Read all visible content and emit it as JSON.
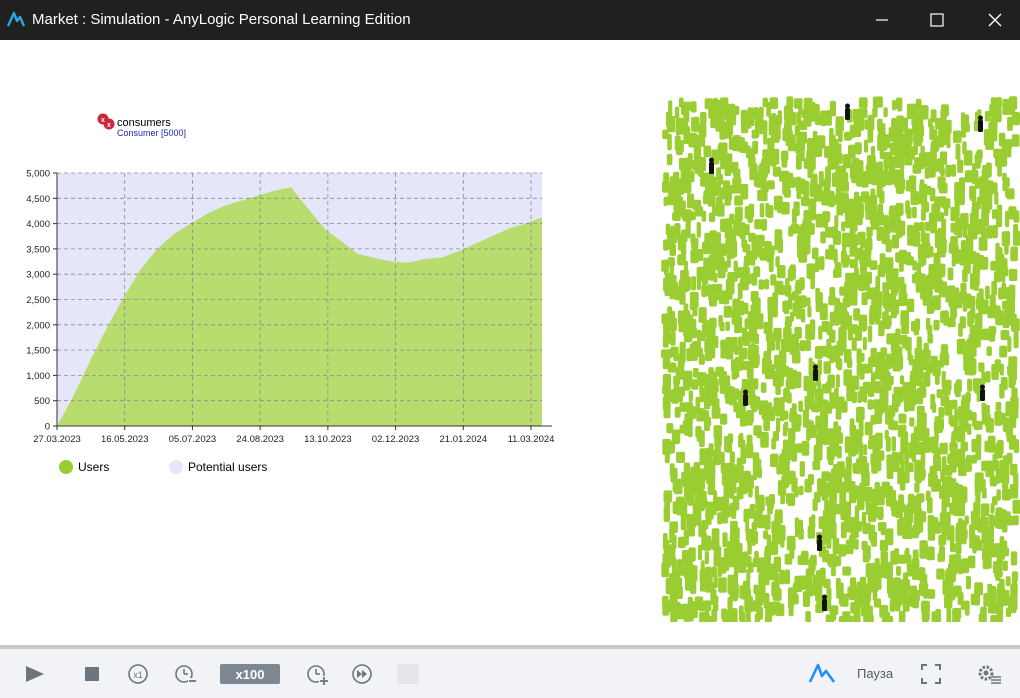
{
  "window": {
    "title": "Market : Simulation - AnyLogic Personal Learning Edition"
  },
  "agent_population": {
    "name": "consumers",
    "type_label": "Consumer [5000]"
  },
  "chart_data": {
    "type": "area",
    "x_tick_labels": [
      "27.03.2023",
      "16.05.2023",
      "05.07.2023",
      "24.08.2023",
      "13.10.2023",
      "02.12.2023",
      "21.01.2024",
      "11.03.2024"
    ],
    "y_tick_labels": [
      "0",
      "500",
      "1,000",
      "1,500",
      "2,000",
      "2,500",
      "3,000",
      "3,500",
      "4,000",
      "4,500",
      "5,000"
    ],
    "ylim": [
      0,
      5000
    ],
    "grid": true,
    "legend_position": "bottom-left",
    "series": [
      {
        "name": "Users",
        "color": "#9acd32",
        "values": [
          0,
          600,
          1300,
          1950,
          2550,
          3100,
          3500,
          3800,
          4000,
          4200,
          4350,
          4450,
          4550,
          4650,
          4720,
          4300,
          3900,
          3650,
          3400,
          3320,
          3250,
          3230,
          3300,
          3330,
          3450,
          3600,
          3750,
          3900,
          4000,
          4120
        ]
      },
      {
        "name": "Potential users",
        "color": "#e6e6fa",
        "values": [
          5000,
          4400,
          3700,
          3050,
          2450,
          1900,
          1500,
          1200,
          1000,
          800,
          650,
          550,
          450,
          350,
          280,
          700,
          1100,
          1350,
          1600,
          1680,
          1750,
          1770,
          1700,
          1670,
          1550,
          1400,
          1250,
          1100,
          1000,
          880
        ]
      }
    ]
  },
  "toolbar": {
    "speed_label": "x100",
    "pause_label": "Пауза",
    "icons": [
      "play-icon",
      "stop-icon",
      "realtime-x1-icon",
      "slow-down-icon",
      "speed-up-icon",
      "fast-forward-icon",
      "anylogic-logo-icon",
      "fullscreen-icon",
      "settings-icon"
    ]
  },
  "colors": {
    "titlebar_bg": "#202020",
    "agent_green": "#9acd32",
    "users_green": "#9acd32",
    "potential_lavender": "#e6e6fa",
    "accent_blue": "#1e90ff"
  }
}
